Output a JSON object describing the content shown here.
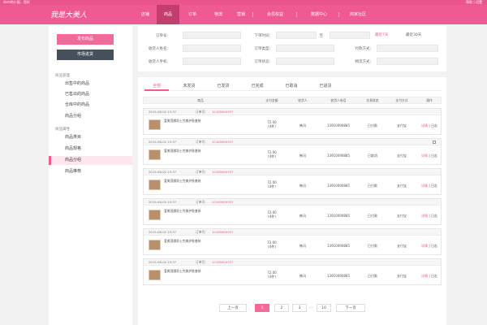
{
  "topbar": {
    "greeting": "dom的小屋，您好",
    "links": "帮助 | 设置"
  },
  "logo": {
    "text": "我是大美人"
  },
  "nav": [
    "店铺",
    "商品",
    "订单",
    "物流",
    "营销",
    "会员权益",
    "数据中心",
    "商家社区"
  ],
  "nav_active": 1,
  "sidebar": {
    "publish_label": "发布商品",
    "market_label": "市场进货",
    "group1_title": "商品管理",
    "group1_items": [
      "出售中的商品",
      "已售出的商品",
      "仓库中的商品",
      "商品分组"
    ],
    "group2_title": "商品属性",
    "group2_items": [
      "商品类目",
      "商品规格",
      "商品分组",
      "商品推荐"
    ],
    "active_item": "商品分组"
  },
  "filter": {
    "order_no_label": "订单号：",
    "order_time_label": "下单时间：",
    "to_label": "至",
    "link_7days": "最近7天",
    "link_30days": "最近30天",
    "buyer_name_label": "收货人姓名：",
    "order_type_label": "订单类型：",
    "pay_method_label": "付款方式：",
    "buyer_phone_label": "收货人手机：",
    "order_status_label": "订单状态：",
    "logistics_label": "物流方式："
  },
  "tabs": [
    "全部",
    "未发货",
    "已发货",
    "已完成",
    "已取消",
    "已退货"
  ],
  "tab_active": 0,
  "table_headers": [
    "商品",
    "支付金额",
    "收货人",
    "收货人电话",
    "交易状态",
    "支付方式",
    "操作"
  ],
  "orders": [
    {
      "date": "2015-08-02 23:37",
      "order_no_label": "订单号：",
      "order_no": "10185809937",
      "product": "爱美莲娜男士完美护肤套装",
      "amount": "72.00",
      "qty": "(4件)",
      "receiver": "韩讯",
      "phone": "13910090885",
      "status": "已付款",
      "pay": "支付宝",
      "op1": "详情",
      "op2": "日志",
      "deletable": false
    },
    {
      "date": "2015-08-02 23:37",
      "order_no_label": "订单号：",
      "order_no": "10185809937",
      "product": "爱美莲娜男士完美护肤套装",
      "amount": "72.00",
      "qty": "(4件)",
      "receiver": "韩讯",
      "phone": "13910090885",
      "status": "已取消",
      "pay": "支付宝",
      "op1": "详情",
      "op2": "日志",
      "deletable": true
    },
    {
      "date": "2015-08-02 23:37",
      "order_no_label": "订单号：",
      "order_no": "10185809937",
      "product": "爱美莲娜男士完美护肤套装",
      "amount": "72.00",
      "qty": "(4件)",
      "receiver": "韩讯",
      "phone": "13910090885",
      "status": "已付款",
      "pay": "支付宝",
      "op1": "详情",
      "op2": "日志",
      "deletable": false
    },
    {
      "date": "2015-08-02 23:37",
      "order_no_label": "订单号：",
      "order_no": "10185809937",
      "product": "爱美莲娜男士完美护肤套装",
      "amount": "72.00",
      "qty": "(4件)",
      "receiver": "韩讯",
      "phone": "13910090885",
      "status": "已付款",
      "pay": "支付宝",
      "op1": "详情",
      "op2": "日志",
      "deletable": false
    },
    {
      "date": "2015-08-02 23:37",
      "order_no_label": "订单号：",
      "order_no": "10185809937",
      "product": "爱美莲娜男士完美护肤套装",
      "amount": "72.00",
      "qty": "(4件)",
      "receiver": "韩讯",
      "phone": "13910090885",
      "status": "已付款",
      "pay": "支付宝",
      "op1": "详情",
      "op2": "日志",
      "deletable": false
    },
    {
      "date": "2015-08-02 23:37",
      "order_no_label": "订单号：",
      "order_no": "10185809937",
      "product": "爱美莲娜男士完美护肤套装",
      "amount": "72.00",
      "qty": "(4件)",
      "receiver": "韩讯",
      "phone": "13910090885",
      "status": "已付款",
      "pay": "支付宝",
      "op1": "详情",
      "op2": "日志",
      "deletable": false
    }
  ],
  "pager": {
    "prev": "上一页",
    "pages": [
      "1",
      "2",
      "3"
    ],
    "dots": "...",
    "last": "10",
    "next": "下一页",
    "active": "1"
  },
  "colors": {
    "accent": "#f05a92",
    "dark_button": "#45505c"
  },
  "icons": {
    "delete": "trash-icon",
    "product": "product-thumbnail"
  }
}
